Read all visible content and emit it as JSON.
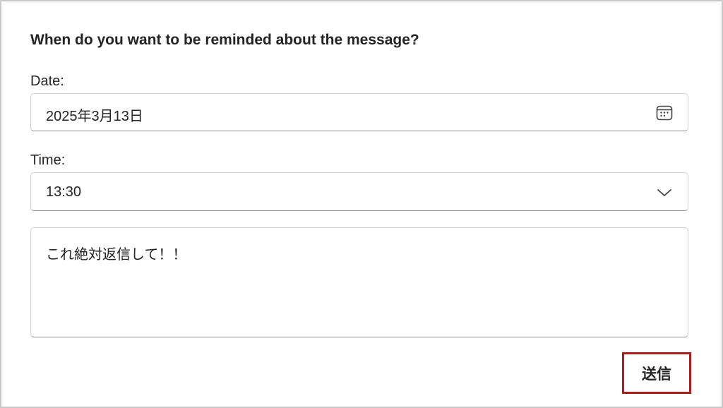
{
  "form": {
    "heading": "When do you want to be reminded about the message?",
    "date_label": "Date:",
    "date_value": "2025年3月13日",
    "time_label": "Time:",
    "time_value": "13:30",
    "message_value": "これ絶対返信して！！",
    "submit_label": "送信"
  },
  "icons": {
    "date_picker": "calendar-icon",
    "time_dropdown": "chevron-down-icon"
  },
  "colors": {
    "highlight_border": "#b01c1c"
  }
}
